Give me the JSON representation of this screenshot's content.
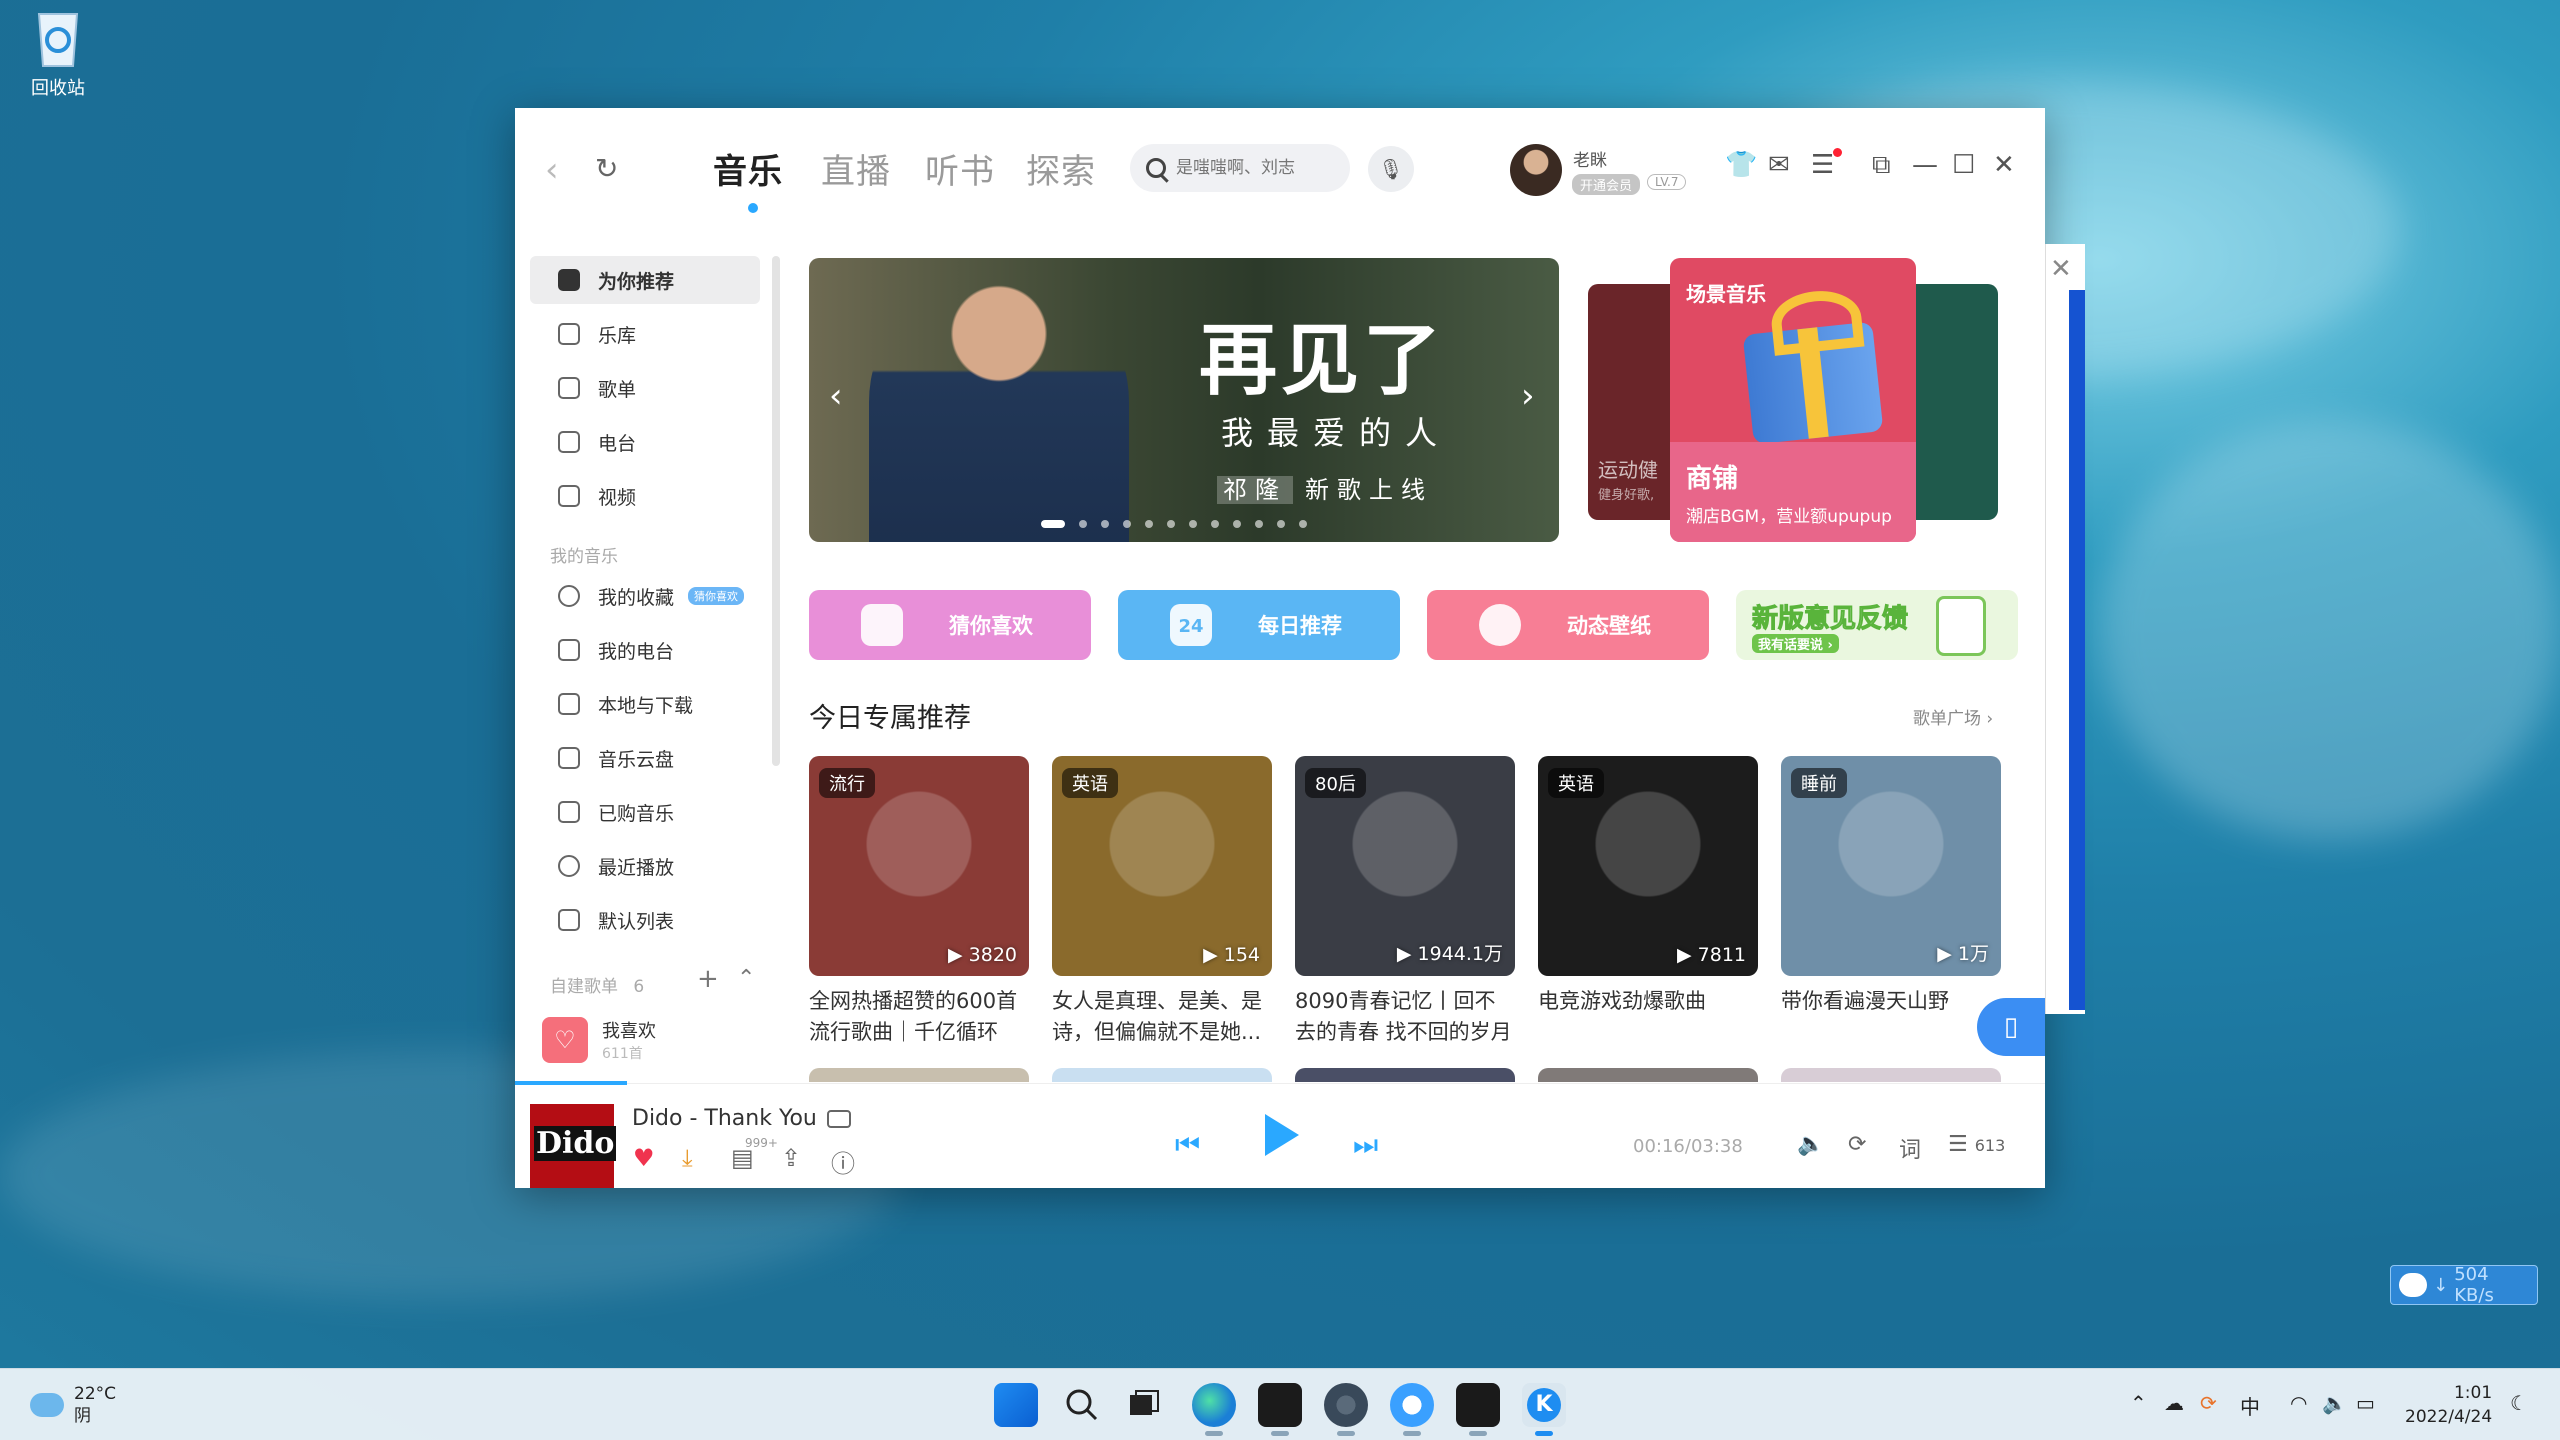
{
  "desktop": {
    "recycle_bin_label": "回收站",
    "net_speed": "504 KB/s"
  },
  "app": {
    "nav": {
      "back_icon": "back-icon",
      "refresh_icon": "refresh-icon"
    },
    "tabs": [
      {
        "label": "音乐",
        "active": true
      },
      {
        "label": "直播"
      },
      {
        "label": "听书"
      },
      {
        "label": "探索"
      }
    ],
    "search": {
      "placeholder": "是嗤嗤啊、刘志"
    },
    "user": {
      "name": "老眯",
      "vip": "开通会员",
      "level": "LV.7"
    },
    "sidebar": {
      "items": [
        {
          "label": "为你推荐",
          "active": true
        },
        {
          "label": "乐库"
        },
        {
          "label": "歌单"
        },
        {
          "label": "电台"
        },
        {
          "label": "视频"
        }
      ],
      "my_music_header": "我的音乐",
      "my_music": [
        {
          "label": "我的收藏",
          "tag": "猜你喜欢"
        },
        {
          "label": "我的电台"
        },
        {
          "label": "本地与下载"
        },
        {
          "label": "音乐云盘"
        },
        {
          "label": "已购音乐"
        },
        {
          "label": "最近播放"
        },
        {
          "label": "默认列表"
        }
      ],
      "playlist_header": "自建歌单",
      "playlist_count": "6",
      "favorite": {
        "title": "我喜欢",
        "count": "611首"
      }
    },
    "banner": {
      "title": "再见了",
      "subtitle": "我最爱的人",
      "artist": "祁隆",
      "tagline": "新歌上线",
      "dot_count": 12,
      "active_dot": 0
    },
    "scene_cards": {
      "main_header": "场景音乐",
      "main_title": "商铺",
      "main_subtitle": "潮店BGM，营业额upupup",
      "left_title": "运动健",
      "left_subtitle": "健身好歌,"
    },
    "quick_buttons": [
      {
        "label": "猜你喜欢",
        "color": "#e88fd8"
      },
      {
        "label": "每日推荐",
        "color": "#5ab6f4",
        "icon_text": "24"
      },
      {
        "label": "动态壁纸",
        "color": "#f77e95"
      }
    ],
    "feedback": {
      "title": "新版意见反馈",
      "sub": "我有话要说 ›"
    },
    "section": {
      "title": "今日专属推荐",
      "more": "歌单广场 ›"
    },
    "playlists": [
      {
        "tag": "流行",
        "plays": "3820",
        "title": "全网热播超赞的600首流行歌曲｜千亿循环",
        "color": "#8a3b36"
      },
      {
        "tag": "英语",
        "plays": "154",
        "title": "女人是真理、是美、是诗，但偏偏就不是她...",
        "color": "#8a6a2c"
      },
      {
        "tag": "80后",
        "plays": "1944.1万",
        "title": "8090青春记忆丨回不去的青春 找不回的岁月",
        "color": "#3a3d45"
      },
      {
        "tag": "英语",
        "plays": "7811",
        "title": "电竞游戏劲爆歌曲",
        "color": "#1c1c1c"
      },
      {
        "tag": "睡前",
        "plays": "1万",
        "title": "带你看遍漫天山野",
        "color": "#6f8fa8"
      }
    ],
    "player": {
      "song": "Dido - Thank You",
      "cover_text": "Dido",
      "comment_count": "999+",
      "time": "00:16/03:38",
      "lyrics_label": "词",
      "queue_count": "613",
      "progress": 0.073
    }
  },
  "taskbar": {
    "weather_temp": "22°C",
    "weather_desc": "阴",
    "ime": "中",
    "time": "1:01",
    "date": "2022/4/24"
  }
}
